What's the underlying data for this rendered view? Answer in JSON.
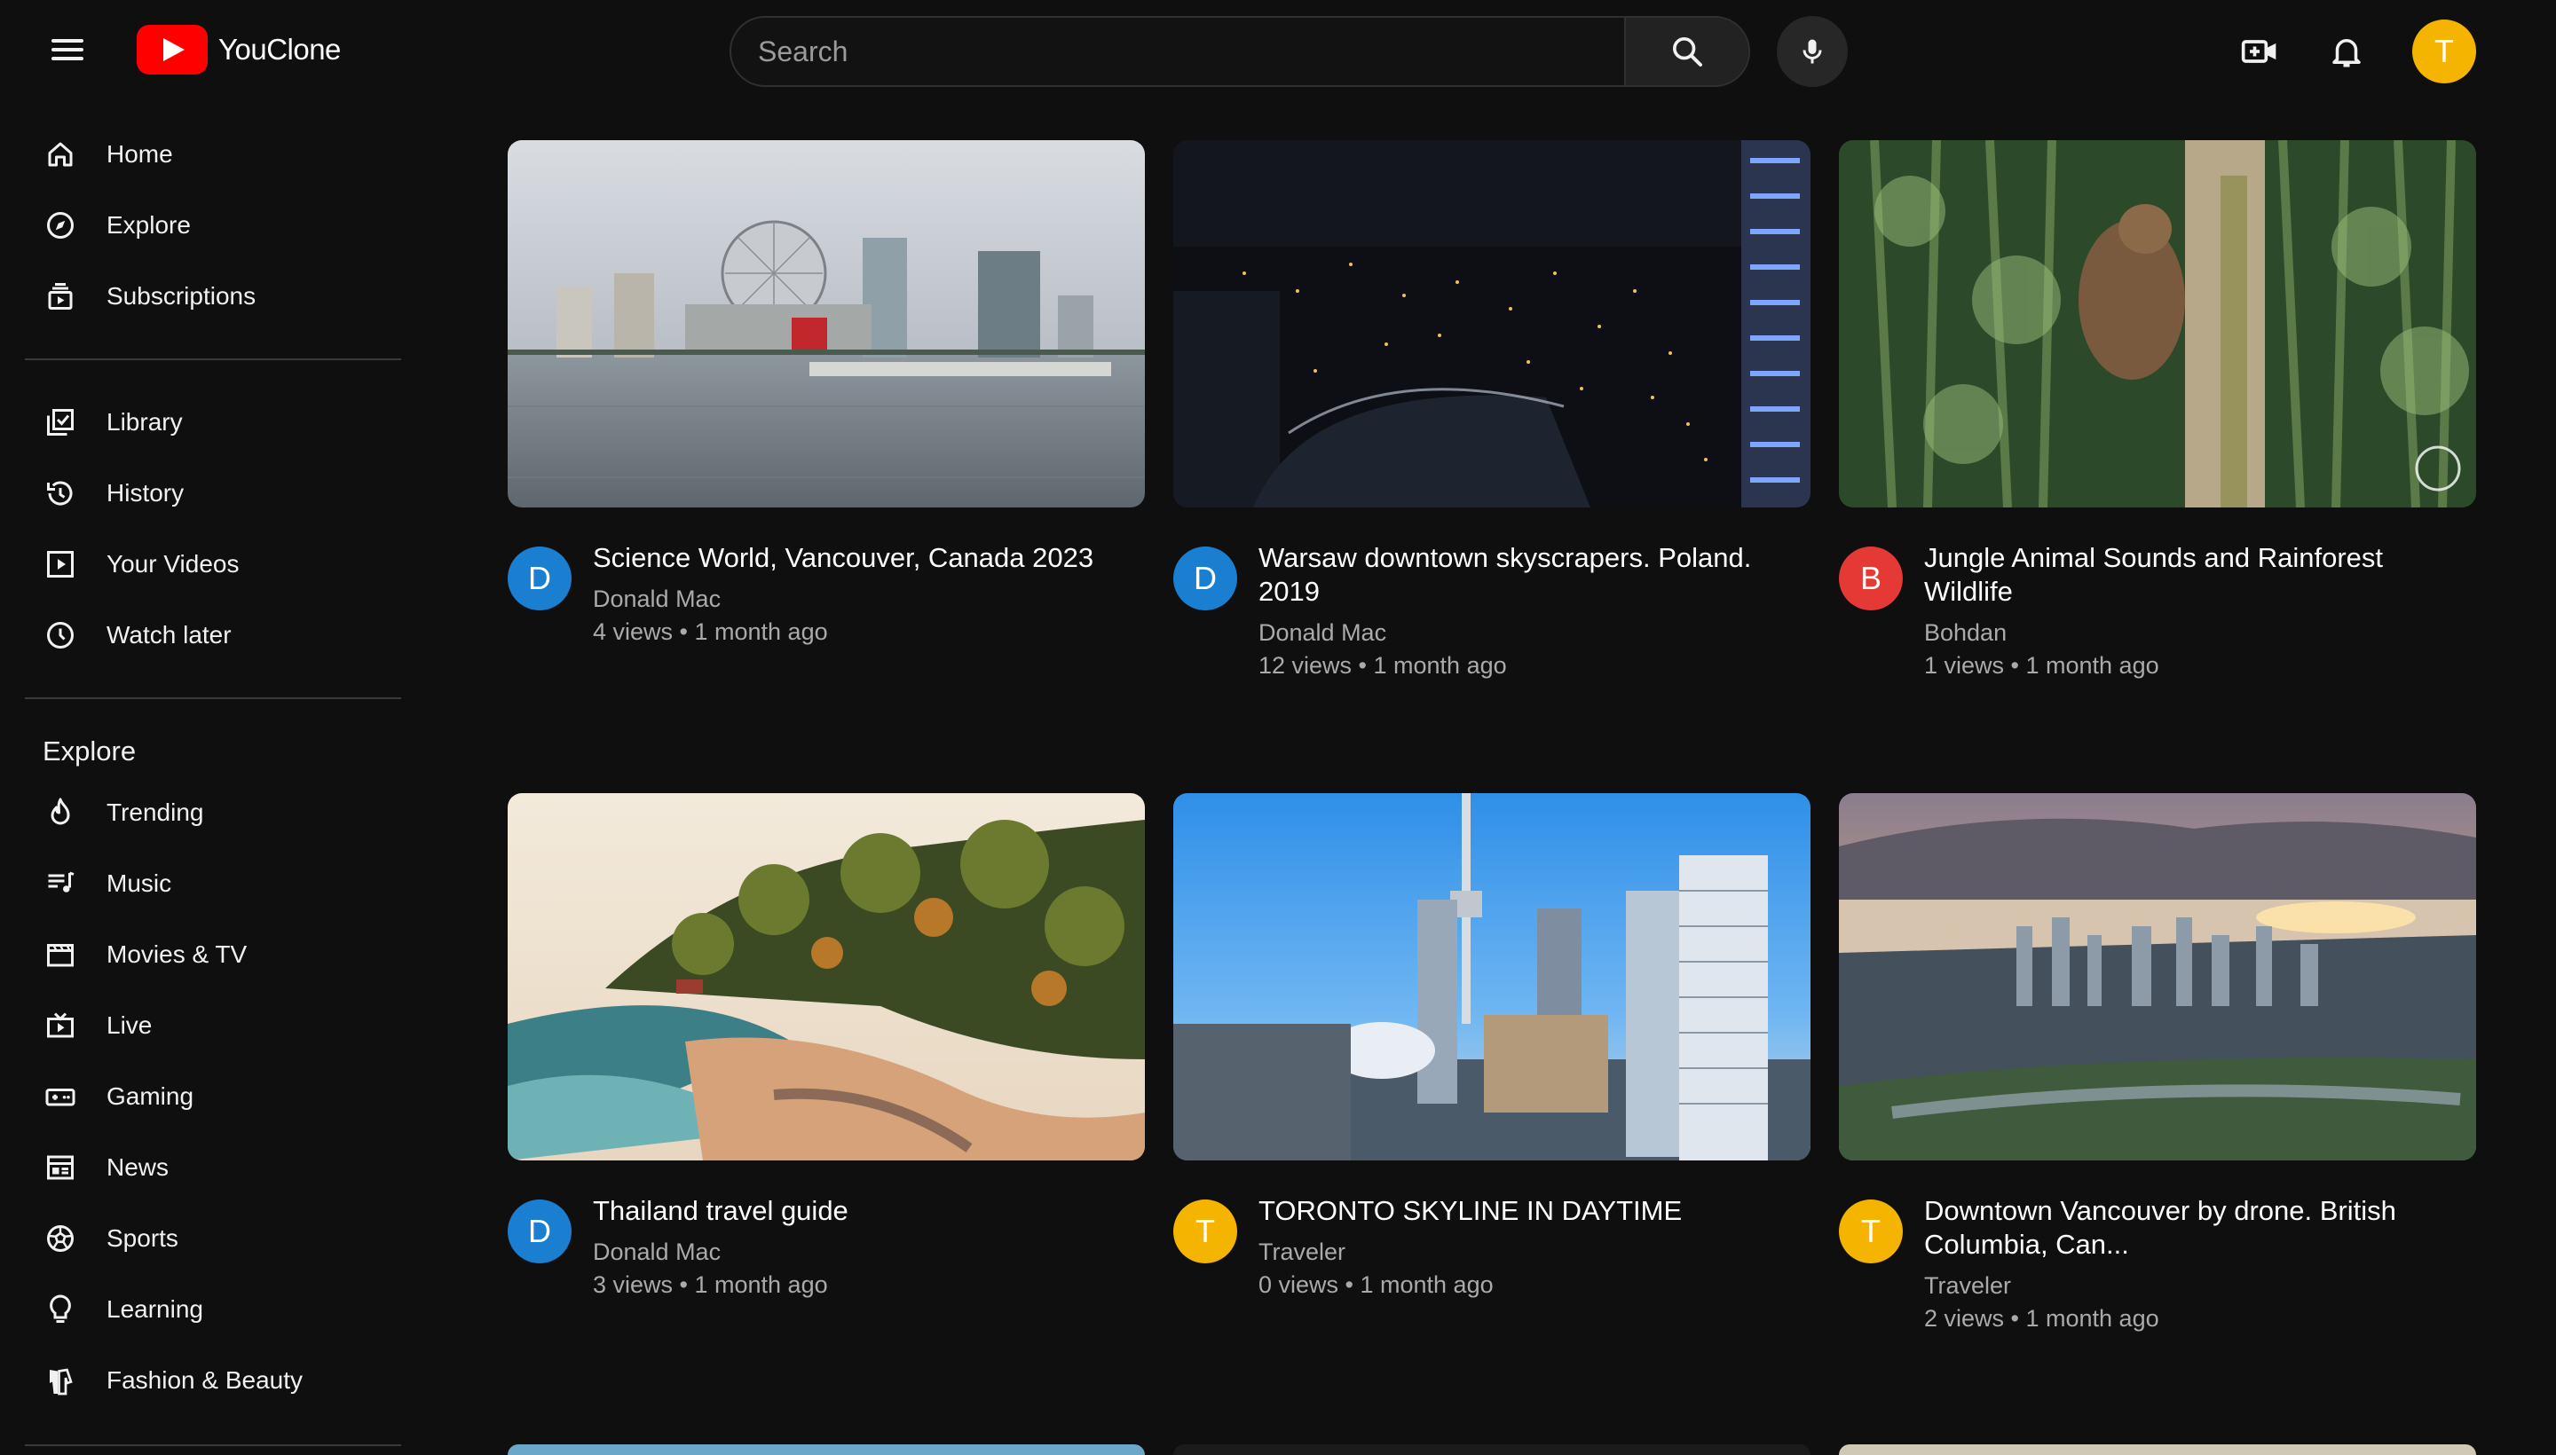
{
  "app": {
    "name": "YouClone"
  },
  "search": {
    "placeholder": "Search"
  },
  "user": {
    "initial": "T",
    "color": "#f4b400"
  },
  "sidebar": {
    "main": [
      {
        "label": "Home",
        "icon": "home-icon"
      },
      {
        "label": "Explore",
        "icon": "compass-icon"
      },
      {
        "label": "Subscriptions",
        "icon": "subscriptions-icon"
      }
    ],
    "library": [
      {
        "label": "Library",
        "icon": "library-icon"
      },
      {
        "label": "History",
        "icon": "history-icon"
      },
      {
        "label": "Your Videos",
        "icon": "your-videos-icon"
      },
      {
        "label": "Watch later",
        "icon": "clock-icon"
      }
    ],
    "explore_heading": "Explore",
    "explore": [
      {
        "label": "Trending",
        "icon": "flame-icon"
      },
      {
        "label": "Music",
        "icon": "music-icon"
      },
      {
        "label": "Movies & TV",
        "icon": "clapperboard-icon"
      },
      {
        "label": "Live",
        "icon": "live-icon"
      },
      {
        "label": "Gaming",
        "icon": "gamepad-icon"
      },
      {
        "label": "News",
        "icon": "newspaper-icon"
      },
      {
        "label": "Sports",
        "icon": "soccer-ball-icon"
      },
      {
        "label": "Learning",
        "icon": "lightbulb-icon"
      },
      {
        "label": "Fashion & Beauty",
        "icon": "hanger-icon"
      }
    ]
  },
  "videos": [
    {
      "title": "Science World, Vancouver, Canada 2023",
      "channel": "Donald Mac",
      "initial": "D",
      "avatar_color": "#1a7fd1",
      "stats": "4 views • 1 month ago"
    },
    {
      "title": "Warsaw downtown skyscrapers. Poland. 2019",
      "channel": "Donald Mac",
      "initial": "D",
      "avatar_color": "#1a7fd1",
      "stats": "12 views • 1 month ago"
    },
    {
      "title": "Jungle Animal Sounds and Rainforest Wildlife",
      "channel": "Bohdan",
      "initial": "B",
      "avatar_color": "#e53935",
      "stats": "1 views • 1 month ago"
    },
    {
      "title": "Thailand travel guide",
      "channel": "Donald Mac",
      "initial": "D",
      "avatar_color": "#1a7fd1",
      "stats": "3 views • 1 month ago"
    },
    {
      "title": "TORONTO SKYLINE IN DAYTIME",
      "channel": "Traveler",
      "initial": "T",
      "avatar_color": "#f4b400",
      "stats": "0 views • 1 month ago"
    },
    {
      "title": "Downtown Vancouver by drone. British Columbia, Can...",
      "channel": "Traveler",
      "initial": "T",
      "avatar_color": "#f4b400",
      "stats": "2 views • 1 month ago"
    }
  ]
}
